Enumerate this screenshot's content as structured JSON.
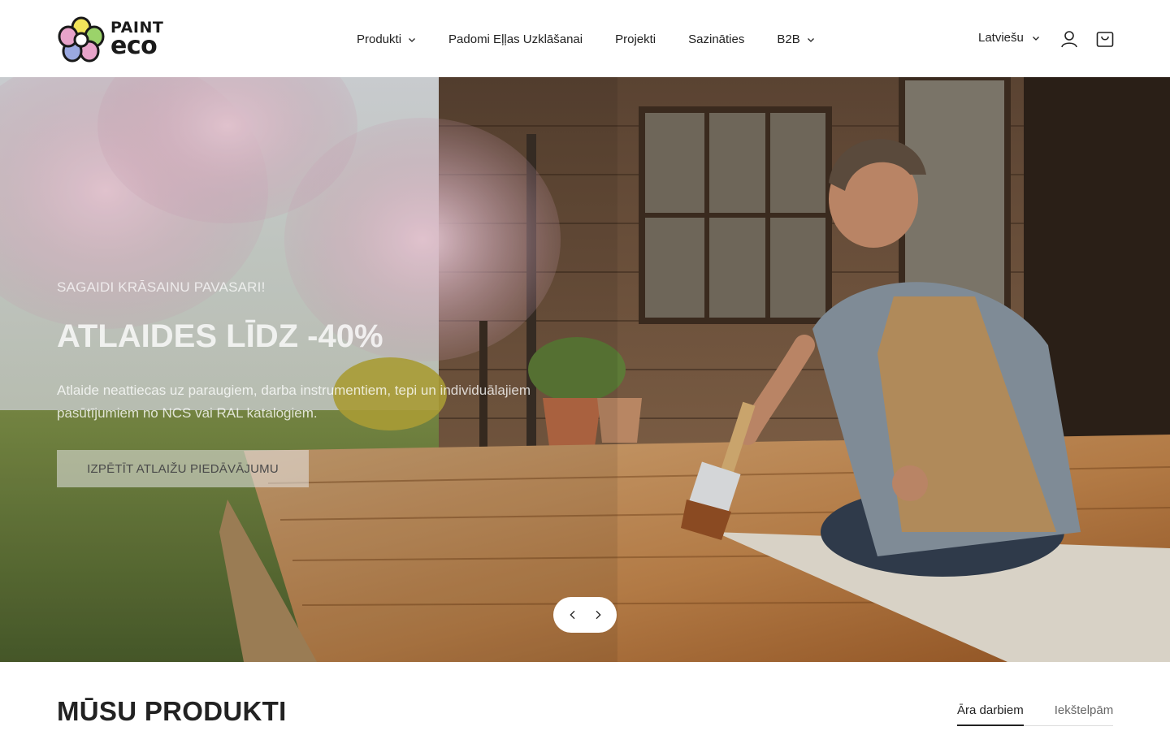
{
  "brand": {
    "line1": "PAINT",
    "line2": "eco",
    "petal_colors": [
      "#f2e45a",
      "#9bd36a",
      "#9aa8e0",
      "#e7a3c9",
      "#c9c9c9"
    ]
  },
  "nav": {
    "items": [
      {
        "label": "Produkti",
        "has_dropdown": true
      },
      {
        "label": "Padomi Eļļas Uzklāšanai",
        "has_dropdown": false
      },
      {
        "label": "Projekti",
        "has_dropdown": false
      },
      {
        "label": "Sazināties",
        "has_dropdown": false
      },
      {
        "label": "B2B",
        "has_dropdown": true
      }
    ]
  },
  "header": {
    "language": "Latviešu",
    "icons": [
      "user-icon",
      "cart-icon"
    ]
  },
  "hero": {
    "eyebrow": "SAGAIDI KRĀSAINU PAVASARI!",
    "title": "ATLAIDES LĪDZ -40%",
    "description": "Atlaide neattiecas uz paraugiem, darba instrumentiem, tepi un individuālajiem pasūtījumiem no NCS vai RAL katalogiem.",
    "cta": "IZPĒTĪT ATLAIŽU PIEDĀVĀJUMU",
    "controls": [
      "chevron-left-icon",
      "chevron-right-icon"
    ]
  },
  "products": {
    "title": "MŪSU PRODUKTI",
    "tabs": [
      {
        "label": "Āra darbiem",
        "active": true
      },
      {
        "label": "Iekštelpām",
        "active": false
      }
    ]
  }
}
